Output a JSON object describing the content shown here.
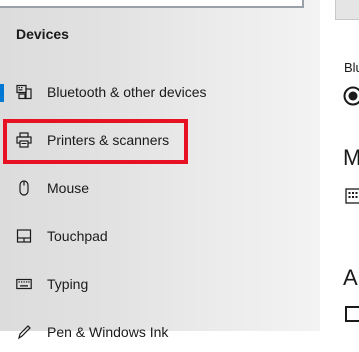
{
  "sidebar": {
    "heading": "Devices",
    "items": [
      {
        "label": "Bluetooth & other devices",
        "icon": "bluetooth-devices-icon",
        "selected": true
      },
      {
        "label": "Printers & scanners",
        "icon": "printer-icon",
        "selected": false,
        "highlighted": true
      },
      {
        "label": "Mouse",
        "icon": "mouse-icon",
        "selected": false
      },
      {
        "label": "Touchpad",
        "icon": "touchpad-icon",
        "selected": false
      },
      {
        "label": "Typing",
        "icon": "keyboard-icon",
        "selected": false
      },
      {
        "label": "Pen & Windows Ink",
        "icon": "pen-icon",
        "selected": false
      }
    ]
  },
  "content": {
    "bluetooth_label": "Blu",
    "more_heading": "M",
    "auto_heading": "Au"
  },
  "colors": {
    "accent": "#0078d4",
    "highlight": "#e81123"
  }
}
